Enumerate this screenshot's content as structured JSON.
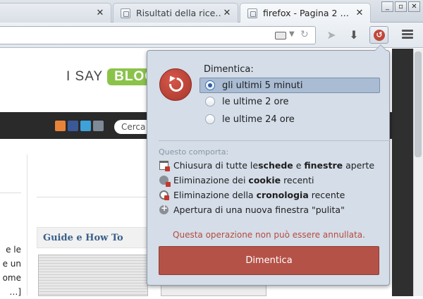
{
  "tabs": [
    {
      "title": "",
      "active": false
    },
    {
      "title": "Risultati della rice…",
      "active": false
    },
    {
      "title": "firefox - Pagina 2 …",
      "active": true
    }
  ],
  "window_buttons": [
    "_",
    "▫",
    "✕"
  ],
  "page": {
    "brand_prefix": "I SAY",
    "brand_badge": "BLOG",
    "search_placeholder": "Cerca",
    "side_text": "e le\ne un\nome\n…]",
    "guide_title": "Guide e How To"
  },
  "panel": {
    "label": "Dimentica:",
    "options": [
      {
        "label": "gli ultimi 5 minuti",
        "selected": true
      },
      {
        "label": "le ultime 2 ore",
        "selected": false
      },
      {
        "label": "le ultime 24 ore",
        "selected": false
      }
    ],
    "consequence_label": "Questo comporta:",
    "effects": [
      {
        "icon": "window-close-icon",
        "parts": [
          "Chiusura di tutte le ",
          "schede",
          " e ",
          "finestre",
          " aperte"
        ]
      },
      {
        "icon": "cookie-icon",
        "parts": [
          "Eliminazione dei ",
          "cookie",
          " recenti"
        ]
      },
      {
        "icon": "history-icon",
        "parts": [
          "Eliminazione della ",
          "cronologia",
          " recente"
        ]
      },
      {
        "icon": "new-window-icon",
        "parts": [
          "Apertura di una nuova finestra \"pulita\""
        ]
      }
    ],
    "warning": "Questa operazione non può essere annullata.",
    "button": "Dimentica"
  },
  "colors": {
    "accent_red": "#b55247",
    "panel_bg": "#d4dde8",
    "selected_bg": "#a9bcd3",
    "brand_green": "#8bc34a"
  }
}
